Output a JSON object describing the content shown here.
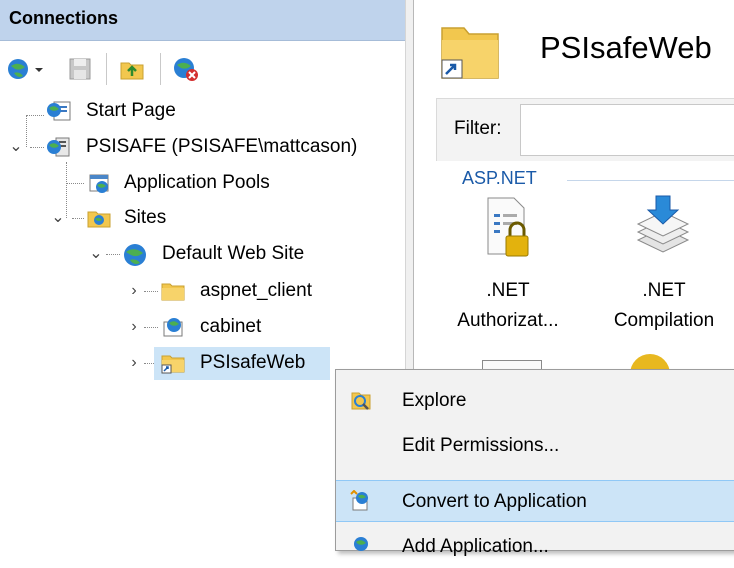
{
  "connections": {
    "title": "Connections"
  },
  "tree": {
    "start_page": "Start Page",
    "server": "PSISAFE (PSISAFE\\mattcason)",
    "app_pools": "Application Pools",
    "sites": "Sites",
    "default_site": "Default Web Site",
    "children": [
      "aspnet_client",
      "cabinet",
      "PSIsafeWeb"
    ]
  },
  "content": {
    "title": "PSIsafeWeb",
    "filter_label": "Filter:",
    "group_label": "ASP.NET",
    "features": [
      {
        "line1": ".NET",
        "line2": "Authorizat...",
        "icon": "lock-document-icon"
      },
      {
        "line1": ".NET",
        "line2": "Compilation",
        "icon": "stack-download-icon"
      }
    ]
  },
  "context_menu": {
    "items": [
      {
        "label": "Explore",
        "icon": "explore-icon"
      },
      {
        "label": "Edit Permissions...",
        "icon": ""
      },
      {
        "label": "Convert to Application",
        "icon": "convert-app-icon"
      },
      {
        "label": "Add Application...",
        "icon": "add-app-icon"
      }
    ]
  },
  "colors": {
    "header_bg": "#bfd3ec",
    "selection": "#cce4f7",
    "group_text": "#1a5aa8"
  }
}
